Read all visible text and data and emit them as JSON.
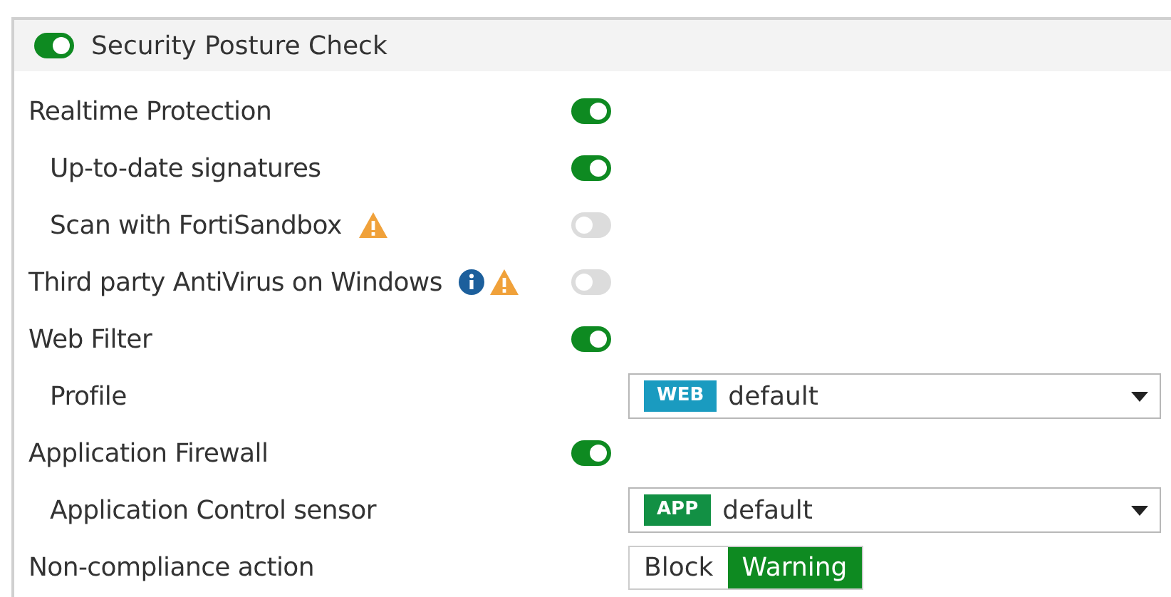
{
  "section": {
    "title": "Security Posture Check",
    "on": true
  },
  "rows": [
    {
      "kind": "toggle",
      "label": "Realtime Protection",
      "on": true,
      "children": [
        {
          "kind": "toggle",
          "label": "Up-to-date signatures",
          "on": true
        },
        {
          "kind": "toggle",
          "label": "Scan with FortiSandbox",
          "on": false,
          "warning": true
        }
      ]
    },
    {
      "kind": "toggle",
      "label": "Third party AntiVirus on Windows",
      "on": false,
      "info": true,
      "warning": true
    },
    {
      "kind": "toggle",
      "label": "Web Filter",
      "on": true,
      "children": [
        {
          "kind": "select",
          "label": "Profile",
          "tag": "WEB",
          "color": "#1a9bc0",
          "value": "default"
        }
      ]
    },
    {
      "kind": "toggle",
      "label": "Application Firewall",
      "on": true,
      "children": [
        {
          "kind": "select",
          "label": "Application Control sensor",
          "tag": "APP",
          "color": "#129044",
          "value": "default"
        }
      ]
    },
    {
      "kind": "segmented",
      "label": "Non-compliance action",
      "options": [
        {
          "label": "Block",
          "selected": false
        },
        {
          "label": "Warning",
          "selected": true
        }
      ]
    }
  ]
}
